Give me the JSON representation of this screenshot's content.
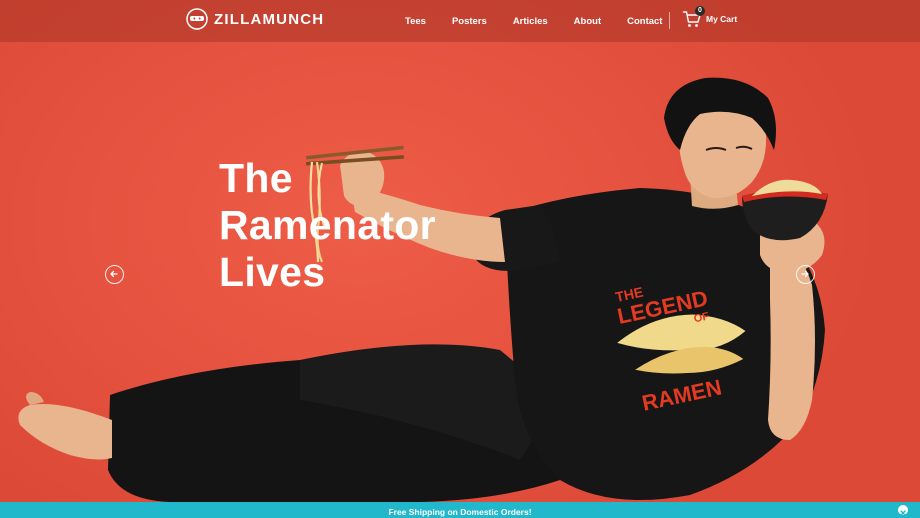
{
  "brand": {
    "name": "ZILLAMUNCH",
    "logo_icon": "ninja-face-icon"
  },
  "nav": {
    "items": [
      {
        "label": "Tees"
      },
      {
        "label": "Posters"
      },
      {
        "label": "Articles"
      },
      {
        "label": "About"
      },
      {
        "label": "Contact"
      }
    ]
  },
  "cart": {
    "label": "My Cart",
    "count": "0",
    "icon": "shopping-cart-icon"
  },
  "hero": {
    "headline_lines": [
      "The",
      "Ramenator",
      "Lives"
    ],
    "shirt_text_1": "THE",
    "shirt_text_2": "LEGEND",
    "shirt_text_3": "OF",
    "shirt_text_4": "RAMEN",
    "prev_icon": "arrow-left-icon",
    "next_icon": "arrow-right-icon"
  },
  "promo": {
    "text": "Free Shipping on Domestic Orders!",
    "close_icon": "close-icon"
  },
  "colors": {
    "hero_bg": "#e5523f",
    "header_bg": "#aa3426",
    "promo_bg": "#21b8cc",
    "text": "#ffffff",
    "shirt": "#1a1a1a"
  }
}
